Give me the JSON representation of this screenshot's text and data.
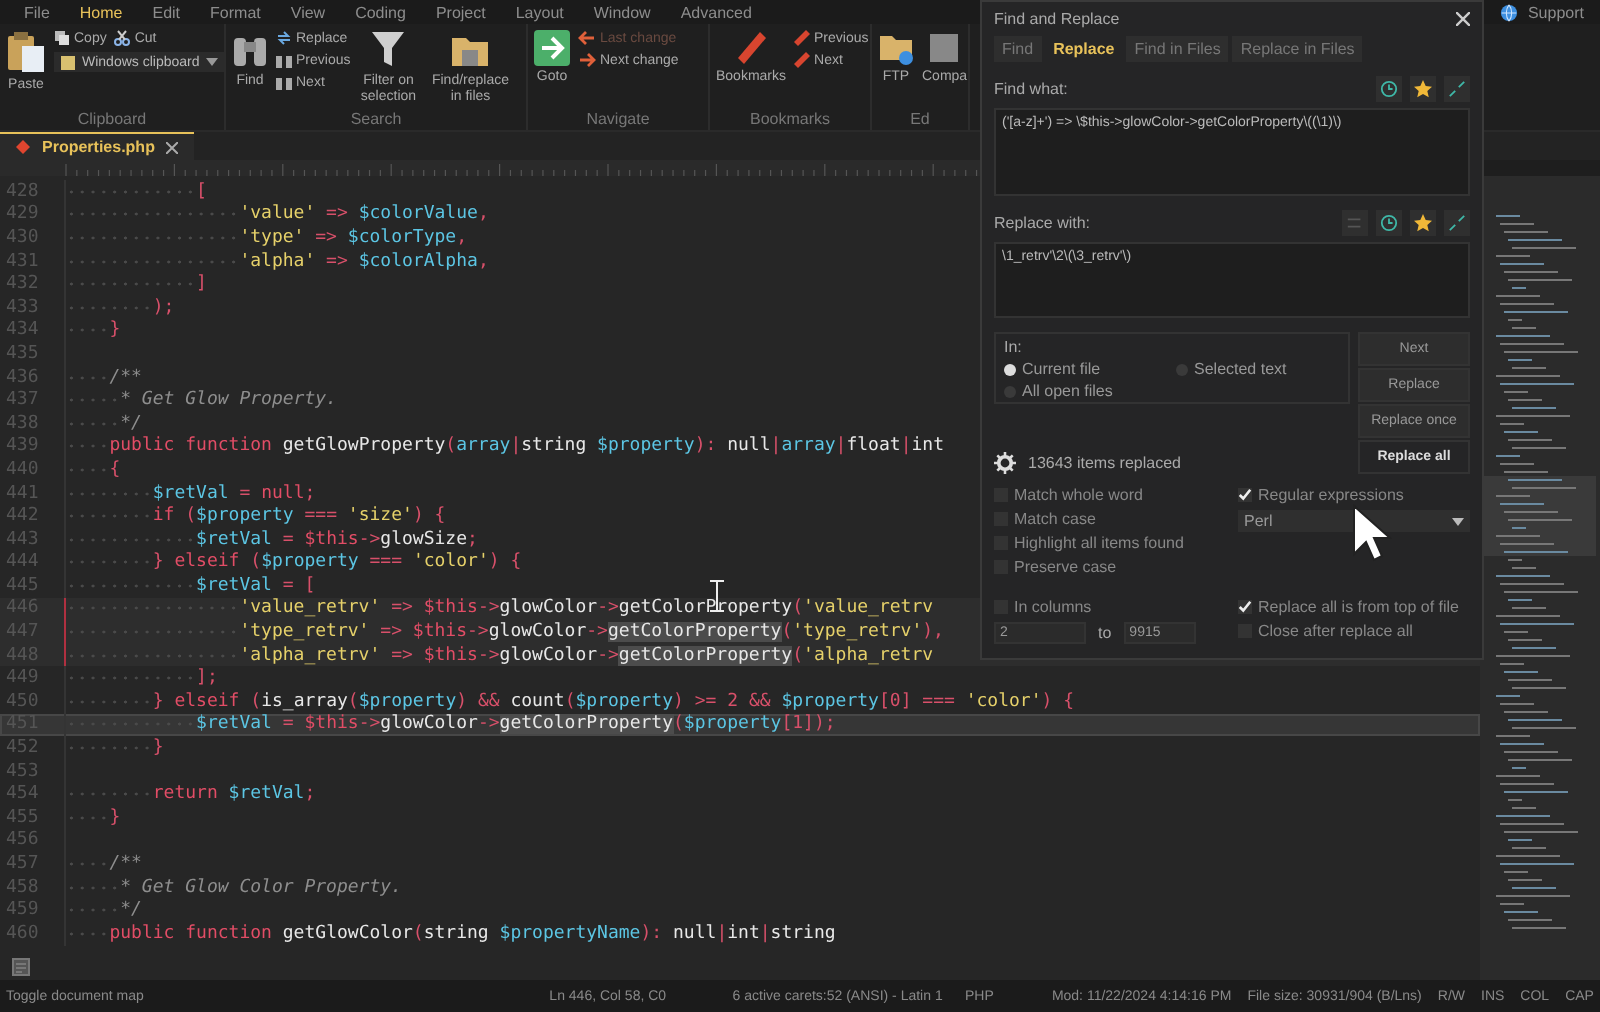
{
  "menu": [
    {
      "label": "File",
      "selected": false
    },
    {
      "label": "Home",
      "selected": true
    },
    {
      "label": "Edit",
      "selected": false
    },
    {
      "label": "Format",
      "selected": false
    },
    {
      "label": "View",
      "selected": false
    },
    {
      "label": "Coding",
      "selected": false
    },
    {
      "label": "Project",
      "selected": false
    },
    {
      "label": "Layout",
      "selected": false
    },
    {
      "label": "Window",
      "selected": false
    },
    {
      "label": "Advanced",
      "selected": false
    }
  ],
  "support": "Support",
  "ribbon": {
    "clipboard": {
      "label": "Clipboard",
      "paste": "Paste",
      "copy": "Copy",
      "cut": "Cut",
      "clipboard_select": "Windows clipboard"
    },
    "search": {
      "label": "Search",
      "find": "Find",
      "replace": "Replace",
      "previous": "Previous",
      "next": "Next",
      "filter": "Filter on selection",
      "find_in_files": "Find/replace in files"
    },
    "navigate": {
      "label": "Navigate",
      "goto": "Goto",
      "last_change": {
        "label": "Last change",
        "disabled": true
      },
      "next_change": {
        "label": "Next change",
        "disabled": false
      }
    },
    "bookmarks": {
      "label": "Bookmarks",
      "bookmarks": "Bookmarks",
      "previous": "Previous",
      "next": "Next"
    },
    "edit": {
      "label": "Ed",
      "ftp": "FTP",
      "compare": "Compa"
    }
  },
  "tabs": [
    {
      "label": "Properties.php",
      "selected": true
    }
  ],
  "lines": [
    {
      "number": "428",
      "current": false,
      "multi_caret": false,
      "tokens": [
        {
          "punct": "            ["
        }
      ]
    },
    {
      "number": "429",
      "current": false,
      "multi_caret": false,
      "tokens": [
        {
          "string": "                'value'"
        },
        {
          "punct": " => "
        },
        {
          "variable": "$colorValue"
        },
        {
          "punct": ","
        }
      ]
    },
    {
      "number": "430",
      "current": false,
      "multi_caret": false,
      "tokens": [
        {
          "string": "                'type'"
        },
        {
          "punct": " => "
        },
        {
          "variable": "$colorType"
        },
        {
          "punct": ","
        }
      ]
    },
    {
      "number": "431",
      "current": false,
      "multi_caret": false,
      "tokens": [
        {
          "string": "                'alpha'"
        },
        {
          "punct": " => "
        },
        {
          "variable": "$colorAlpha"
        },
        {
          "punct": ","
        }
      ]
    },
    {
      "number": "432",
      "current": false,
      "multi_caret": false,
      "tokens": [
        {
          "punct": "            ]"
        }
      ]
    },
    {
      "number": "433",
      "current": false,
      "multi_caret": false,
      "tokens": [
        {
          "punct": "        );"
        }
      ]
    },
    {
      "number": "434",
      "current": false,
      "multi_caret": false,
      "tokens": [
        {
          "punct": "    }"
        }
      ]
    },
    {
      "number": "435",
      "current": false,
      "multi_caret": false
    },
    {
      "number": "436",
      "current": false,
      "multi_caret": false,
      "tokens": [
        {
          "comment": "    /**"
        }
      ]
    },
    {
      "number": "437",
      "current": false,
      "multi_caret": false,
      "tokens": [
        {
          "comment": "     * Get Glow Property."
        }
      ]
    },
    {
      "number": "438",
      "current": false,
      "multi_caret": false,
      "tokens": [
        {
          "comment": "     */"
        }
      ]
    },
    {
      "number": "439",
      "current": false,
      "multi_caret": false,
      "tokens": [
        {
          "keyword": "    public function "
        },
        {
          "name": "getGlowProperty"
        },
        {
          "punct": "("
        },
        {
          "variable": "array"
        },
        {
          "punct": "|"
        },
        {
          "name": "string "
        },
        {
          "variable": "$property"
        },
        {
          "punct": "): "
        },
        {
          "name": "null"
        },
        {
          "punct": "|"
        },
        {
          "variable": "array"
        },
        {
          "punct": "|"
        },
        {
          "name": "float"
        },
        {
          "punct": "|"
        },
        {
          "name": "int"
        }
      ]
    },
    {
      "number": "440",
      "current": false,
      "multi_caret": false,
      "tokens": [
        {
          "punct": "    {"
        }
      ]
    },
    {
      "number": "441",
      "current": false,
      "multi_caret": false,
      "tokens": [
        {
          "variable": "        $retVal"
        },
        {
          "punct": " = "
        },
        {
          "keyword": "null"
        },
        {
          "punct": ";"
        }
      ]
    },
    {
      "number": "442",
      "current": false,
      "multi_caret": false,
      "tokens": [
        {
          "keyword": "        if "
        },
        {
          "punct": "("
        },
        {
          "variable": "$property"
        },
        {
          "punct": " === "
        },
        {
          "string": "'size'"
        },
        {
          "punct": ") {"
        }
      ]
    },
    {
      "number": "443",
      "current": false,
      "multi_caret": false,
      "tokens": [
        {
          "variable": "            $retVal"
        },
        {
          "punct": " = "
        },
        {
          "keyword": "$this"
        },
        {
          "punct": "->"
        },
        {
          "name": "glowSize"
        },
        {
          "punct": ";"
        }
      ]
    },
    {
      "number": "444",
      "current": false,
      "multi_caret": false,
      "tokens": [
        {
          "punct": "        } "
        },
        {
          "keyword": "elseif "
        },
        {
          "punct": "("
        },
        {
          "variable": "$property"
        },
        {
          "punct": " === "
        },
        {
          "string": "'color'"
        },
        {
          "punct": ") {"
        }
      ]
    },
    {
      "number": "445",
      "current": false,
      "multi_caret": false,
      "tokens": [
        {
          "variable": "            $retVal"
        },
        {
          "punct": " = ["
        }
      ]
    },
    {
      "number": "446",
      "current": false,
      "multi_caret": true,
      "tokens": [
        {
          "string": "                'value_retrv'"
        },
        {
          "punct": " => "
        },
        {
          "keyword": "$this"
        },
        {
          "punct": "->"
        },
        {
          "name": "glowColor"
        },
        {
          "punct": "->"
        },
        {
          "name": "getColorProperty"
        },
        {
          "punct": "("
        },
        {
          "string": "'value_retrv"
        }
      ]
    },
    {
      "number": "447",
      "current": false,
      "multi_caret": true,
      "tokens": [
        {
          "string": "                'type_retrv'"
        },
        {
          "punct": " => "
        },
        {
          "keyword": "$this"
        },
        {
          "punct": "->"
        },
        {
          "name": "glowColor"
        },
        {
          "punct": "->"
        },
        {
          "match": "getColorProperty"
        },
        {
          "punct": "("
        },
        {
          "string": "'type_retrv'"
        },
        {
          "punct": "),"
        }
      ]
    },
    {
      "number": "448",
      "current": false,
      "multi_caret": true,
      "tokens": [
        {
          "string": "                'alpha_retrv'"
        },
        {
          "punct": " => "
        },
        {
          "keyword": "$this"
        },
        {
          "punct": "->"
        },
        {
          "name": "glowColor"
        },
        {
          "punct": "->"
        },
        {
          "match": "getColorProperty"
        },
        {
          "punct": "("
        },
        {
          "string": "'alpha_retrv"
        }
      ]
    },
    {
      "number": "449",
      "current": false,
      "multi_caret": false,
      "tokens": [
        {
          "punct": "            ];"
        }
      ]
    },
    {
      "number": "450",
      "current": false,
      "multi_caret": false,
      "tokens": [
        {
          "punct": "        } "
        },
        {
          "keyword": "elseif "
        },
        {
          "punct": "("
        },
        {
          "name": "is_array"
        },
        {
          "punct": "("
        },
        {
          "variable": "$property"
        },
        {
          "punct": ") && "
        },
        {
          "name": "count"
        },
        {
          "punct": "("
        },
        {
          "variable": "$property"
        },
        {
          "punct": ") >= 2 && "
        },
        {
          "variable": "$property"
        },
        {
          "punct": "[0] === "
        },
        {
          "string": "'color'"
        },
        {
          "punct": ") {"
        }
      ]
    },
    {
      "number": "451",
      "current": true,
      "multi_caret": false,
      "tokens": [
        {
          "variable": "            $retVal"
        },
        {
          "punct": " = "
        },
        {
          "keyword": "$this"
        },
        {
          "punct": "->"
        },
        {
          "name": "glowColor"
        },
        {
          "punct": "->"
        },
        {
          "match": "getColorProperty"
        },
        {
          "punct": "("
        },
        {
          "variable": "$property"
        },
        {
          "punct": "[1]);"
        }
      ]
    },
    {
      "number": "452",
      "current": false,
      "multi_caret": false,
      "tokens": [
        {
          "punct": "        }"
        }
      ]
    },
    {
      "number": "453",
      "current": false,
      "multi_caret": false
    },
    {
      "number": "454",
      "current": false,
      "multi_caret": false,
      "tokens": [
        {
          "keyword": "        return "
        },
        {
          "variable": "$retVal"
        },
        {
          "punct": ";"
        }
      ]
    },
    {
      "number": "455",
      "current": false,
      "multi_caret": false,
      "tokens": [
        {
          "punct": "    }"
        }
      ]
    },
    {
      "number": "456",
      "current": false,
      "multi_caret": false
    },
    {
      "number": "457",
      "current": false,
      "multi_caret": false,
      "tokens": [
        {
          "comment": "    /**"
        }
      ]
    },
    {
      "number": "458",
      "current": false,
      "multi_caret": false,
      "tokens": [
        {
          "comment": "     * Get Glow Color Property."
        }
      ]
    },
    {
      "number": "459",
      "current": false,
      "multi_caret": false,
      "tokens": [
        {
          "comment": "     */"
        }
      ]
    },
    {
      "number": "460",
      "current": false,
      "multi_caret": false,
      "tokens": [
        {
          "keyword": "    public function "
        },
        {
          "name": "getGlowColor"
        },
        {
          "punct": "("
        },
        {
          "name": "string "
        },
        {
          "variable": "$propertyName"
        },
        {
          "punct": "): "
        },
        {
          "name": "null"
        },
        {
          "punct": "|"
        },
        {
          "name": "int"
        },
        {
          "punct": "|"
        },
        {
          "name": "string"
        }
      ]
    }
  ],
  "dialog": {
    "title": "Find and Replace",
    "tabs": [
      {
        "label": "Find",
        "selected": false
      },
      {
        "label": "Replace",
        "selected": true
      },
      {
        "label": "Find in Files",
        "selected": false
      },
      {
        "label": "Replace in Files",
        "selected": false
      }
    ],
    "find_label": "Find what:",
    "find_value": "('[a-z]+') => \\$this->glowColor->getColorProperty\\((\\1)\\)",
    "replace_label": "Replace with:",
    "replace_value": "\\1_retrv'\\2\\(\\3_retrv'\\)",
    "in_label": "In:",
    "scope": [
      {
        "label": "Current file",
        "selected": true
      },
      {
        "label": "Selected text",
        "selected": false
      },
      {
        "label": "All open files",
        "selected": false
      }
    ],
    "buttons": [
      {
        "label": "Next",
        "primary": false
      },
      {
        "label": "Replace",
        "primary": false
      },
      {
        "label": "Replace once",
        "primary": false
      },
      {
        "label": "Replace all",
        "primary": true
      }
    ],
    "status": "13643 items replaced",
    "options_left": [
      {
        "label": "Match whole word",
        "checked": false
      },
      {
        "label": "Match case",
        "checked": false
      },
      {
        "label": "Highlight all items found",
        "checked": false
      },
      {
        "label": "Preserve case",
        "checked": false
      }
    ],
    "regex": {
      "label": "Regular expressions",
      "checked": true
    },
    "regex_engine": "Perl",
    "in_columns": {
      "label": "In columns",
      "checked": false
    },
    "from_top": {
      "label": "Replace all is from top of file",
      "checked": true
    },
    "range_from": "2",
    "range_to_label": "to",
    "range_to": "9915",
    "close_after": {
      "label": "Close after replace all",
      "checked": false
    }
  },
  "status_bar": {
    "hint": "Toggle document map",
    "position": "Ln 446, Col 58, C0",
    "encoding": "6 active carets:52 (ANSI) - Latin 1",
    "language": "PHP",
    "modified": "Mod: 11/22/2024 4:14:16 PM",
    "file_size": "File size: 30931/904 (B/Lns)",
    "flags": [
      "R/W",
      "INS",
      "COL",
      "CAP"
    ]
  }
}
